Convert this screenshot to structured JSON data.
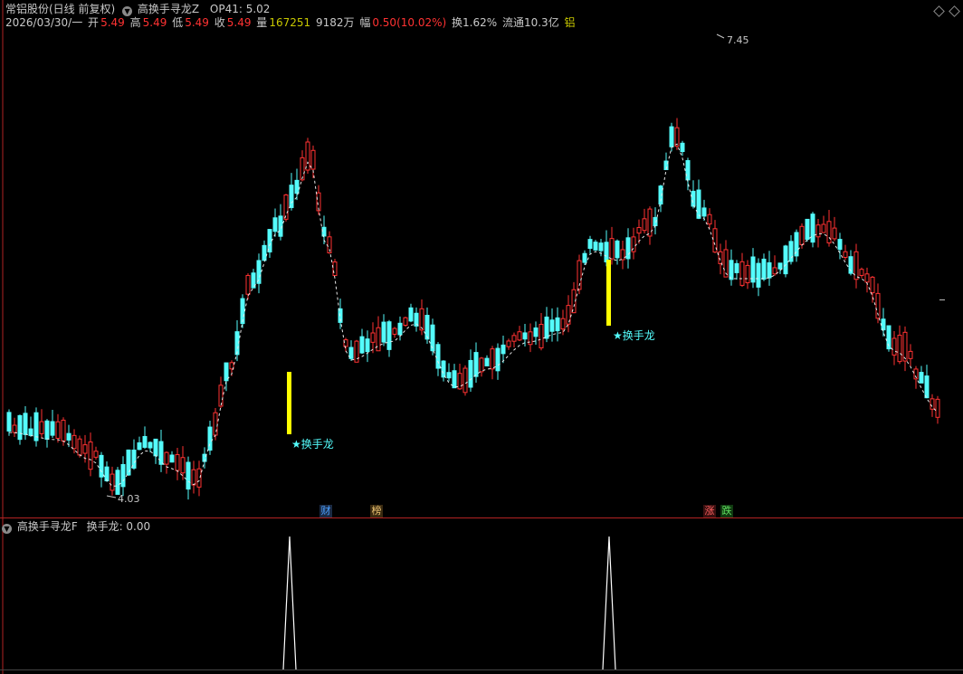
{
  "main_header": {
    "stock_name": "常铝股份(日线 前复权)",
    "indicator_name": "高换手寻龙Z",
    "op41_label": "OP41: 5.02",
    "date": "2026/03/30/一",
    "open_label": "开",
    "open": "5.49",
    "high_label": "高",
    "high": "5.49",
    "low_label": "低",
    "low": "5.49",
    "close_label": "收",
    "close": "5.49",
    "volume_label": "量",
    "volume": "167251",
    "amount_label": "额",
    "amount": "9182万",
    "change_label": "幅",
    "change": "0.50(10.02%)",
    "turnover": "换1.62%",
    "float": "流通10.3亿",
    "sector": "铝"
  },
  "sub_header": {
    "indicator_name": "高换手寻龙F",
    "value_label": "换手龙: 0.00"
  },
  "annotations": {
    "high_price": "7.45",
    "low_price": "4.03",
    "signal_text": "★换手龙"
  },
  "tags": {
    "cai": "财",
    "bang": "榜",
    "zhang": "涨",
    "die": "跌"
  },
  "colors": {
    "up": "#ff3232",
    "down": "#54fcfc",
    "signal": "#ffff00",
    "panel_border": "#b22222",
    "volume_yellow": "#c8c800",
    "price_red": "#ff3232"
  },
  "chart_data": {
    "type": "candlestick",
    "price_range_visible": [
      4.03,
      7.45
    ],
    "signal_bars": [
      50,
      106
    ],
    "indicator_peaks": [
      1,
      1
    ]
  }
}
